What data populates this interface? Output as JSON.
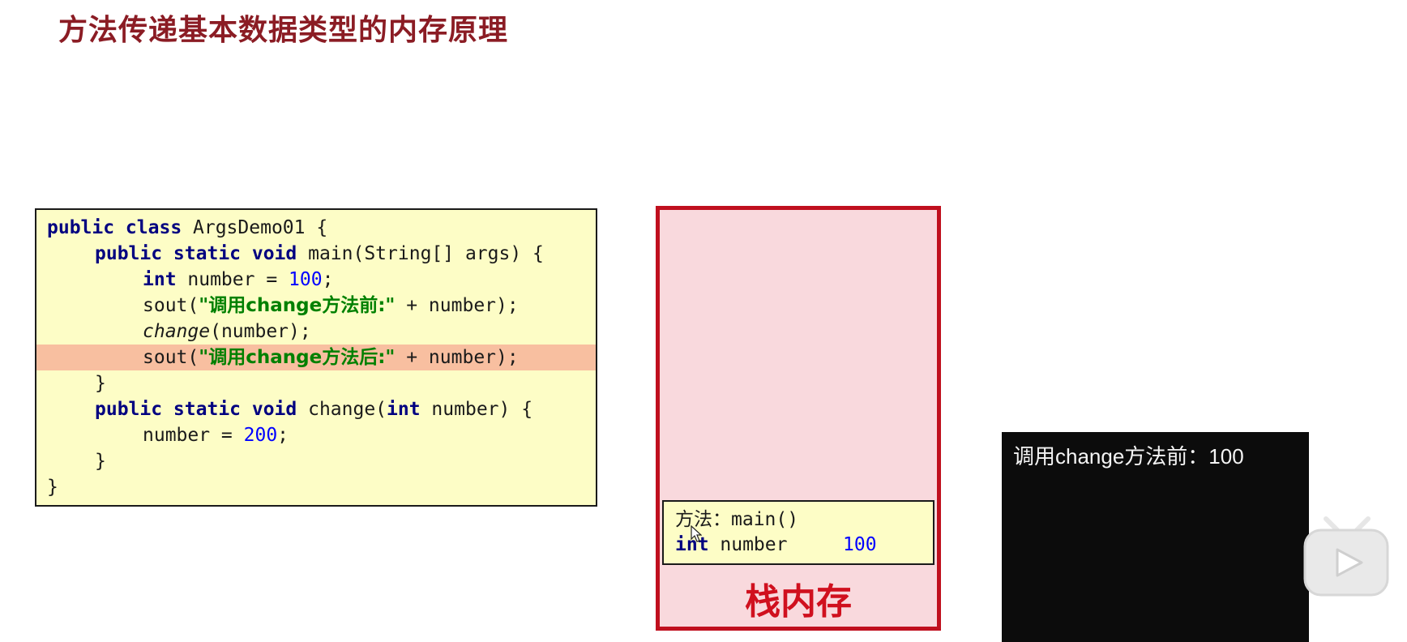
{
  "title": "方法传递基本数据类型的内存原理",
  "code": {
    "l1_kw": "public class",
    "l1_rest": " ArgsDemo01 {",
    "l2_kw": "public static void",
    "l2_rest": " main(String[] args) {",
    "l3_kw": "int",
    "l3_mid": " number = ",
    "l3_num": "100",
    "l3_end": ";",
    "l4_pre": "sout(",
    "l4_str": "\"调用change方法前:\"",
    "l4_end": " + number);",
    "l5_fn": "change",
    "l5_end": "(number);",
    "l6_pre": "sout(",
    "l6_str": "\"调用change方法后:\"",
    "l6_end": " + number);",
    "l7": "}",
    "l8_kw": "public static void",
    "l8_mid": " change(",
    "l8_kw2": "int",
    "l8_end": " number) {",
    "l9_mid": "number = ",
    "l9_num": "200",
    "l9_end": ";",
    "l10": "}",
    "l11": "}"
  },
  "stack": {
    "frame_title": "方法：main()",
    "var_type": "int",
    "var_name": " number",
    "var_value": "100",
    "label": "栈内存"
  },
  "console": {
    "output": "调用change方法前：100"
  },
  "colors": {
    "title": "#8b1c24",
    "stack_border": "#c0101e",
    "stack_fill": "#f9d9dd",
    "code_bg": "#fdfdc6",
    "highlight": "#f8bfa0",
    "keyword": "#000080",
    "number": "#0000ff",
    "string": "#008000"
  }
}
